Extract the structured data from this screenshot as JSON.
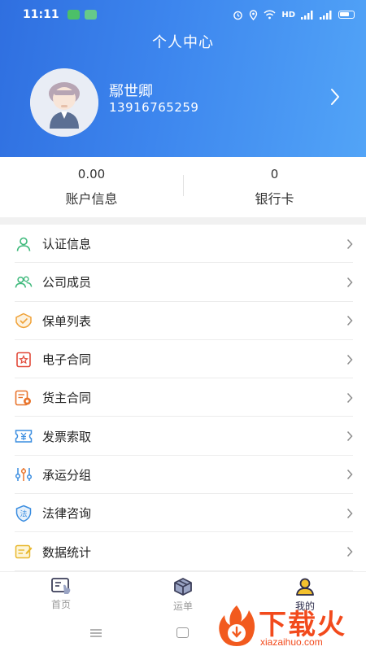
{
  "status_bar": {
    "time": "11:11",
    "network": "HD"
  },
  "header": {
    "title": "个人中心",
    "user_name": "鄢世卿",
    "phone": "13916765259"
  },
  "summary": [
    {
      "value": "0.00",
      "label": "账户信息"
    },
    {
      "value": "0",
      "label": "银行卡"
    }
  ],
  "menu": {
    "items": [
      {
        "label": "认证信息",
        "icon": "user-icon"
      },
      {
        "label": "公司成员",
        "icon": "members-icon"
      },
      {
        "label": "保单列表",
        "icon": "shield-check-icon"
      },
      {
        "label": "电子合同",
        "icon": "contract-star-icon"
      },
      {
        "label": "货主合同",
        "icon": "document-icon"
      },
      {
        "label": "发票索取",
        "icon": "invoice-icon"
      },
      {
        "label": "承运分组",
        "icon": "sliders-icon"
      },
      {
        "label": "法律咨询",
        "icon": "law-shield-icon"
      },
      {
        "label": "数据统计",
        "icon": "stats-note-icon"
      }
    ]
  },
  "tabbar": {
    "tabs": [
      {
        "label": "首页",
        "icon": "home-board-icon"
      },
      {
        "label": "运单",
        "icon": "package-box-icon"
      },
      {
        "label": "我的",
        "icon": "profile-icon"
      }
    ],
    "active": "我的"
  },
  "watermark": {
    "title": "下载火",
    "url": "xiazaihuo.com"
  },
  "colors": {
    "header_start": "#2f6fe0",
    "header_end": "#52a4f7",
    "icon_green": "#3cb87a",
    "icon_orange": "#f0a238",
    "icon_red": "#e24b3b",
    "icon_blue": "#3a8de0",
    "watermark": "#f24a1c"
  }
}
